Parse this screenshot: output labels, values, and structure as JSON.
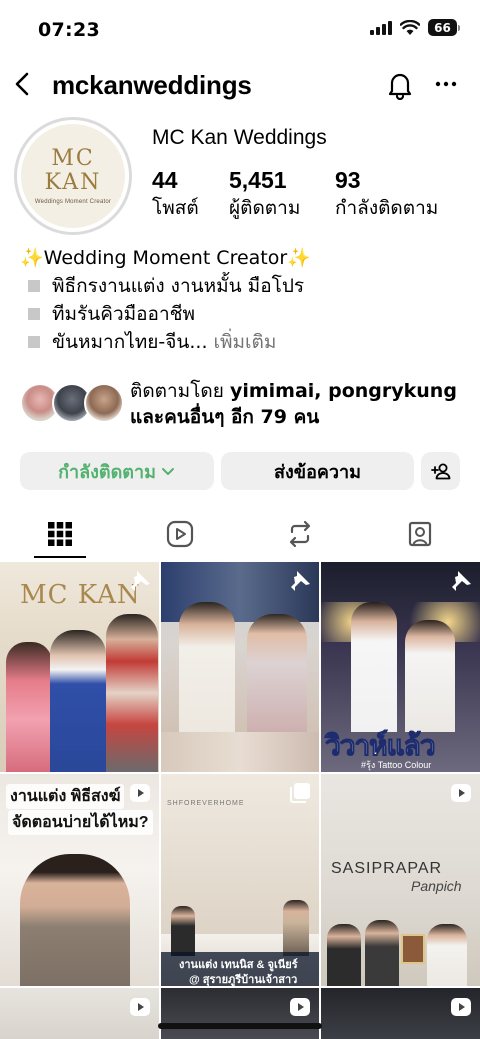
{
  "status": {
    "time": "07:23",
    "battery": "66"
  },
  "nav": {
    "username": "mckanweddings"
  },
  "profile": {
    "display_name": "MC Kan Weddings",
    "logo_line1": "MC",
    "logo_line2": "KAN",
    "logo_sub": "Weddings Moment Creator",
    "stats": [
      {
        "value": "44",
        "label": "โพสต์"
      },
      {
        "value": "5,451",
        "label": "ผู้ติดตาม"
      },
      {
        "value": "93",
        "label": "กำลังติดตาม"
      }
    ],
    "bio": {
      "headline": "✨Wedding Moment Creator✨",
      "lines": [
        "พิธีกรงานแต่ง งานหมั้น มือโปร",
        "ทีมรันคิวมืออาชีพ",
        "ขันหมากไทย-จีน..."
      ],
      "more": "เพิ่มเติม"
    },
    "followed_by": {
      "prefix": "ติดตามโดย",
      "names": "yimimai, pongrykung",
      "line2": "และคนอื่นๆ อีก 79 คน"
    }
  },
  "actions": {
    "following": "กำลังติดตาม",
    "message": "ส่งข้อความ"
  },
  "tabs": [
    "grid-icon",
    "reels-icon",
    "reposts-icon",
    "tagged-icon"
  ],
  "grid": {
    "post1_logo": "MC KAN",
    "post3_caption": "วิวาห์แล้ว",
    "post3_sub": "#รุ้ง Tattoo Colour",
    "post4_caption1": "งานแต่ง พิธีสงฆ์",
    "post4_caption2": "จัดตอนบ่ายได้ไหม?",
    "post5_sign": "SHFOREVERHOME",
    "post5_caption1": "งานแต่ง เทนนิส & จูเนียร์",
    "post5_caption2": "@ สุรายภูรีบ้านเจ้าสาว",
    "post6_sign1": "SASIPRAPAR",
    "post6_sign2": "Panpich"
  },
  "colors": {
    "accent_green": "#53b26f",
    "button_bg": "#efefef",
    "gold": "#9c7b3f"
  }
}
